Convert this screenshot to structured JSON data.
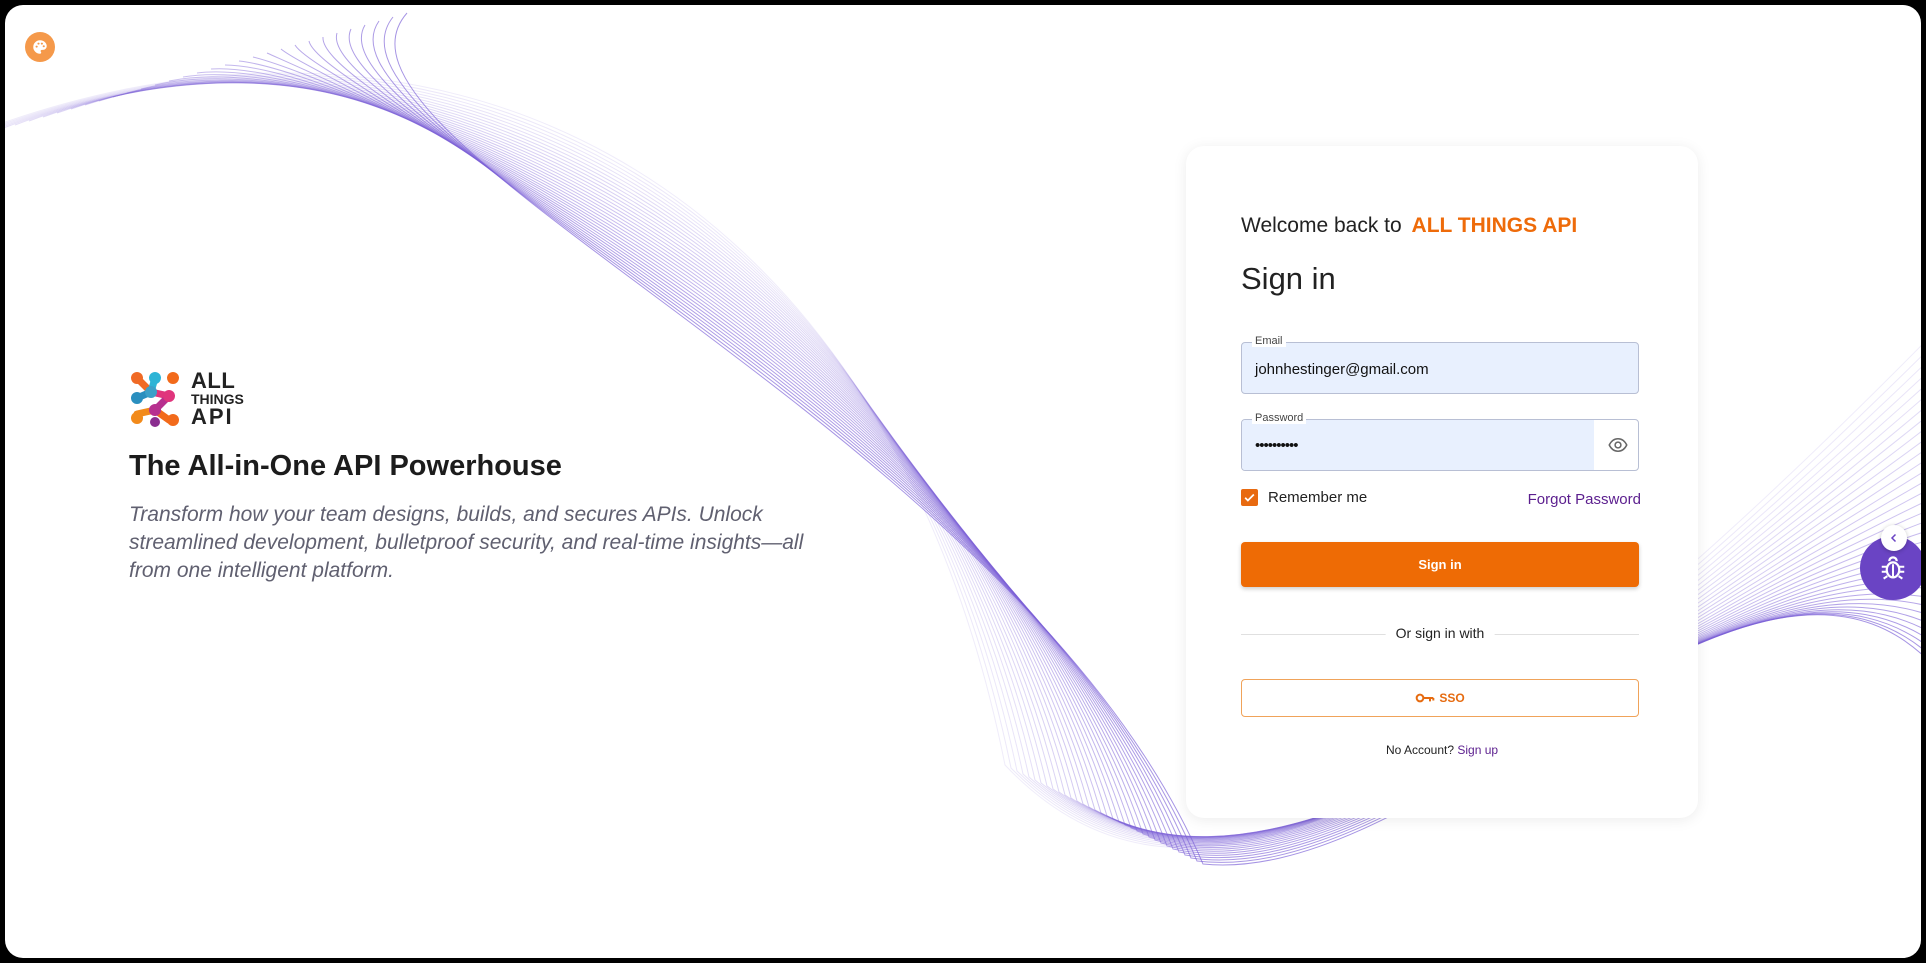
{
  "hero": {
    "logo_line1": "ALL",
    "logo_line2": "THINGS",
    "logo_line3": "API",
    "title": "The All-in-One API Powerhouse",
    "subtitle": "Transform how your team designs, builds, and secures APIs. Unlock streamlined development, bulletproof security, and real-time insights—all from one intelligent platform."
  },
  "card": {
    "welcome": "Welcome back to",
    "brand": "ALL THINGS API",
    "title": "Sign in",
    "email_label": "Email",
    "email_value": "johnhestinger@gmail.com",
    "password_label": "Password",
    "password_value": "••••••••••",
    "remember_label": "Remember me",
    "remember_checked": true,
    "forgot_label": "Forgot Password",
    "signin_label": "Sign in",
    "divider_text": "Or sign in with",
    "sso_label": "SSO",
    "no_account_text": "No Account?",
    "signup_label": "Sign up"
  },
  "icons": {
    "palette": "palette-icon",
    "eye": "eye-icon",
    "key": "key-icon",
    "bug": "bug-icon",
    "chevron": "chevron-left-icon"
  },
  "colors": {
    "accent": "#ee6b05",
    "link": "#5b1e8e",
    "wave": "#7b5fd6",
    "debug": "#6a44c4"
  }
}
